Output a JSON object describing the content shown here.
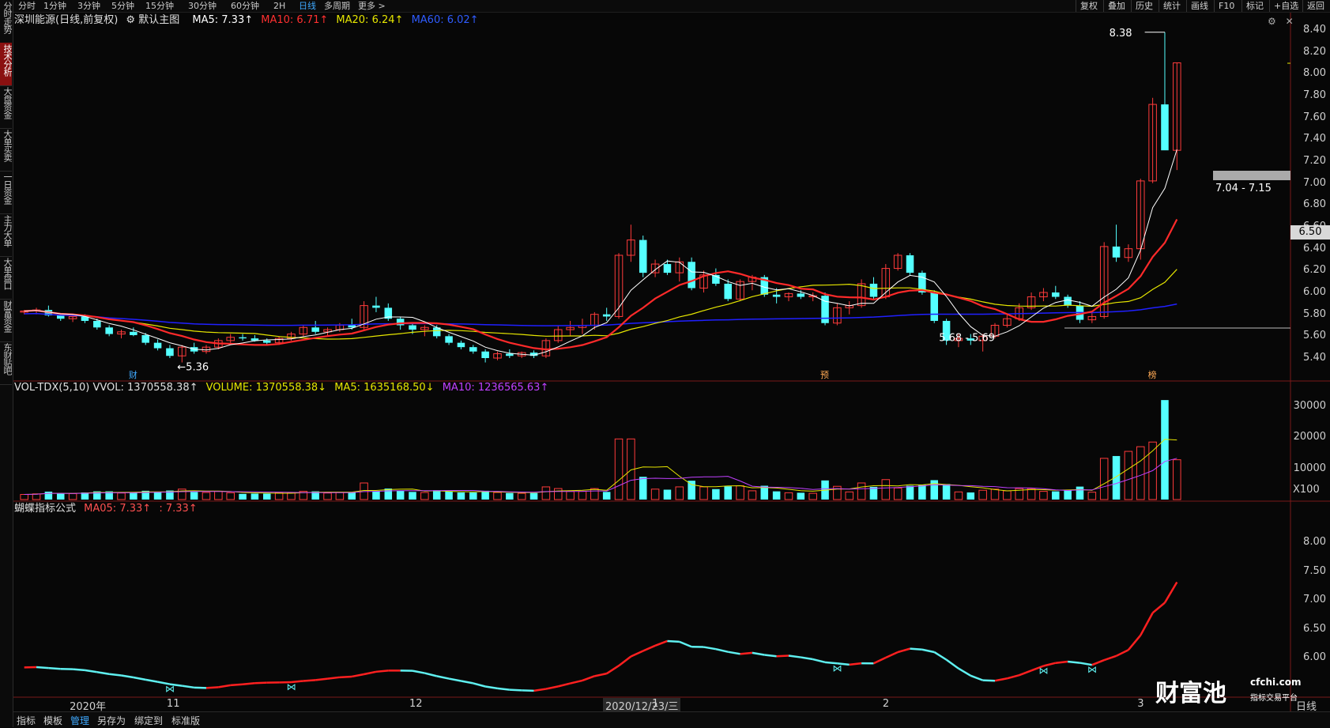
{
  "sidebar": {
    "tabs": [
      {
        "label": "分时走势",
        "active": false
      },
      {
        "label": "技术分析",
        "active": true
      },
      {
        "label": "大盘资金",
        "active": false
      },
      {
        "label": "大单买卖",
        "active": false
      },
      {
        "label": "一日资金",
        "active": false
      },
      {
        "label": "主力大单",
        "active": false
      },
      {
        "label": "大单盘口",
        "active": false
      },
      {
        "label": "财富资金",
        "active": false
      },
      {
        "label": "东财贴吧",
        "active": false
      }
    ]
  },
  "toolbar": {
    "periods": [
      "分时",
      "1分钟",
      "3分钟",
      "5分钟",
      "15分钟",
      "30分钟",
      "60分钟",
      "2H",
      "日线",
      "多周期",
      "更多 >"
    ],
    "active_period": "日线",
    "right_items": [
      "复权",
      "叠加",
      "历史",
      "统计",
      "画线",
      "F10",
      "标记",
      "+自选",
      "返回"
    ]
  },
  "main_chart": {
    "stock_name": "深圳能源(日线,前复权)",
    "indicator": "默认主图",
    "ma5": "MA5: 7.33↑",
    "ma10": "MA10: 6.71↑",
    "ma20": "MA20: 6.24↑",
    "ma60": "MA60: 6.02↑",
    "y_ticks": [
      "8.40",
      "8.20",
      "8.00",
      "7.80",
      "7.60",
      "7.40",
      "7.20",
      "7.00",
      "6.80",
      "6.60",
      "6.40",
      "6.20",
      "6.00",
      "5.80",
      "5.60",
      "5.40"
    ],
    "current_price": "6.50",
    "annotations": {
      "high": "8.38",
      "low_left": "←5.36",
      "gap_mid": "5.68 - 5.69",
      "gap_high": "7.04 - 7.15",
      "markers": [
        "财",
        "预",
        "榜"
      ]
    }
  },
  "volume_chart": {
    "title": "VOL-TDX(5,10) VVOL: 1370558.38↑",
    "volume": "VOLUME: 1370558.38↓",
    "ma5": "MA5: 1635168.50↓",
    "ma10": "MA10: 1236565.63↑",
    "y_ticks": [
      "30000",
      "20000",
      "10000"
    ],
    "unit": "X100"
  },
  "butterfly_chart": {
    "title": "蝴蝶指标公式",
    "ma05": "MA05: 7.33↑",
    "ma05_b": ": 7.33↑",
    "y_ticks": [
      "8.00",
      "7.50",
      "7.00",
      "6.50",
      "6.00"
    ]
  },
  "x_axis": {
    "labels": [
      "2020年",
      "11",
      "12",
      "2020/12/23/三",
      "1",
      "2",
      "3",
      "日线"
    ]
  },
  "bottom_tabs": [
    "指标",
    "模板",
    "管理",
    "另存为",
    "绑定到",
    "标准版"
  ],
  "active_bottom_tab": "管理",
  "watermark": {
    "brand": "财富池",
    "site": "cfchi.com",
    "slogan": "指标交易平台"
  },
  "colors": {
    "up": "#ff3b3b",
    "down": "#54ffff",
    "ma5": "#ffffff",
    "ma10": "#ff2a2a",
    "ma20": "#e6e600",
    "ma60": "#2020ff",
    "ma10_vol": "#c040ff",
    "bg": "#070707",
    "grid": "#5a1010"
  },
  "chart_data": {
    "type": "candlestick",
    "candles": [
      [
        5.82,
        5.84,
        5.8,
        5.83
      ],
      [
        5.83,
        5.86,
        5.8,
        5.84
      ],
      [
        5.84,
        5.88,
        5.78,
        5.79
      ],
      [
        5.79,
        5.8,
        5.74,
        5.76
      ],
      [
        5.76,
        5.79,
        5.73,
        5.78
      ],
      [
        5.78,
        5.8,
        5.72,
        5.74
      ],
      [
        5.74,
        5.76,
        5.66,
        5.68
      ],
      [
        5.68,
        5.7,
        5.6,
        5.62
      ],
      [
        5.62,
        5.66,
        5.58,
        5.64
      ],
      [
        5.64,
        5.68,
        5.6,
        5.61
      ],
      [
        5.61,
        5.63,
        5.52,
        5.54
      ],
      [
        5.54,
        5.57,
        5.47,
        5.49
      ],
      [
        5.49,
        5.52,
        5.4,
        5.42
      ],
      [
        5.42,
        5.52,
        5.36,
        5.5
      ],
      [
        5.5,
        5.54,
        5.44,
        5.46
      ],
      [
        5.46,
        5.52,
        5.44,
        5.5
      ],
      [
        5.5,
        5.58,
        5.48,
        5.56
      ],
      [
        5.56,
        5.62,
        5.54,
        5.59
      ],
      [
        5.59,
        5.62,
        5.56,
        5.58
      ],
      [
        5.58,
        5.61,
        5.55,
        5.56
      ],
      [
        5.56,
        5.58,
        5.52,
        5.54
      ],
      [
        5.54,
        5.6,
        5.52,
        5.58
      ],
      [
        5.58,
        5.64,
        5.56,
        5.62
      ],
      [
        5.62,
        5.7,
        5.6,
        5.68
      ],
      [
        5.68,
        5.74,
        5.62,
        5.64
      ],
      [
        5.64,
        5.68,
        5.6,
        5.66
      ],
      [
        5.66,
        5.72,
        5.64,
        5.7
      ],
      [
        5.7,
        5.76,
        5.66,
        5.68
      ],
      [
        5.68,
        5.92,
        5.66,
        5.88
      ],
      [
        5.88,
        5.96,
        5.82,
        5.86
      ],
      [
        5.86,
        5.9,
        5.74,
        5.76
      ],
      [
        5.76,
        5.78,
        5.66,
        5.7
      ],
      [
        5.7,
        5.72,
        5.62,
        5.66
      ],
      [
        5.66,
        5.7,
        5.6,
        5.68
      ],
      [
        5.68,
        5.7,
        5.58,
        5.6
      ],
      [
        5.6,
        5.62,
        5.52,
        5.54
      ],
      [
        5.54,
        5.56,
        5.48,
        5.5
      ],
      [
        5.5,
        5.52,
        5.44,
        5.46
      ],
      [
        5.46,
        5.48,
        5.36,
        5.4
      ],
      [
        5.4,
        5.46,
        5.38,
        5.44
      ],
      [
        5.44,
        5.48,
        5.4,
        5.42
      ],
      [
        5.42,
        5.46,
        5.4,
        5.45
      ],
      [
        5.45,
        5.47,
        5.4,
        5.42
      ],
      [
        5.42,
        5.58,
        5.4,
        5.56
      ],
      [
        5.56,
        5.7,
        5.54,
        5.66
      ],
      [
        5.66,
        5.74,
        5.6,
        5.68
      ],
      [
        5.68,
        5.76,
        5.62,
        5.7
      ],
      [
        5.7,
        5.82,
        5.66,
        5.8
      ],
      [
        5.8,
        5.86,
        5.74,
        5.78
      ],
      [
        5.78,
        6.36,
        5.76,
        6.34
      ],
      [
        6.34,
        6.62,
        6.28,
        6.48
      ],
      [
        6.48,
        6.52,
        6.14,
        6.18
      ],
      [
        6.18,
        6.3,
        6.14,
        6.26
      ],
      [
        6.26,
        6.3,
        6.16,
        6.18
      ],
      [
        6.18,
        6.32,
        6.1,
        6.28
      ],
      [
        6.28,
        6.32,
        6.02,
        6.04
      ],
      [
        6.04,
        6.2,
        6.0,
        6.16
      ],
      [
        6.16,
        6.22,
        6.06,
        6.08
      ],
      [
        6.08,
        6.12,
        5.92,
        5.94
      ],
      [
        5.94,
        6.12,
        5.92,
        6.1
      ],
      [
        6.1,
        6.16,
        6.02,
        6.14
      ],
      [
        6.14,
        6.16,
        5.96,
        5.98
      ],
      [
        5.98,
        6.04,
        5.9,
        5.96
      ],
      [
        5.96,
        6.0,
        5.92,
        5.99
      ],
      [
        5.99,
        6.02,
        5.94,
        5.96
      ],
      [
        5.96,
        6.0,
        5.92,
        5.97
      ],
      [
        5.97,
        6.0,
        5.7,
        5.72
      ],
      [
        5.72,
        5.9,
        5.7,
        5.86
      ],
      [
        5.86,
        5.92,
        5.8,
        5.88
      ],
      [
        5.88,
        6.12,
        5.86,
        6.08
      ],
      [
        6.08,
        6.14,
        5.94,
        5.96
      ],
      [
        5.96,
        6.26,
        5.94,
        6.22
      ],
      [
        6.22,
        6.36,
        6.2,
        6.34
      ],
      [
        6.34,
        6.36,
        6.16,
        6.18
      ],
      [
        6.18,
        6.2,
        5.98,
        6.0
      ],
      [
        6.0,
        6.02,
        5.72,
        5.74
      ],
      [
        5.74,
        5.76,
        5.52,
        5.56
      ],
      [
        5.56,
        5.62,
        5.5,
        5.58
      ],
      [
        5.58,
        5.62,
        5.52,
        5.56
      ],
      [
        5.56,
        5.62,
        5.46,
        5.6
      ],
      [
        5.6,
        5.72,
        5.58,
        5.7
      ],
      [
        5.7,
        5.8,
        5.68,
        5.76
      ],
      [
        5.76,
        5.9,
        5.74,
        5.86
      ],
      [
        5.86,
        6.0,
        5.84,
        5.96
      ],
      [
        5.96,
        6.04,
        5.92,
        6.0
      ],
      [
        6.0,
        6.06,
        5.94,
        5.96
      ],
      [
        5.96,
        5.98,
        5.86,
        5.88
      ],
      [
        5.88,
        5.92,
        5.72,
        5.75
      ],
      [
        5.75,
        5.82,
        5.72,
        5.78
      ],
      [
        5.78,
        6.46,
        5.76,
        6.42
      ],
      [
        6.42,
        6.62,
        6.28,
        6.32
      ],
      [
        6.32,
        6.44,
        6.28,
        6.4
      ],
      [
        6.4,
        7.04,
        6.3,
        7.02
      ],
      [
        7.02,
        7.78,
        7.0,
        7.72
      ],
      [
        7.72,
        8.38,
        7.38,
        7.3
      ],
      [
        7.3,
        8.1,
        7.12,
        8.1
      ]
    ]
  }
}
